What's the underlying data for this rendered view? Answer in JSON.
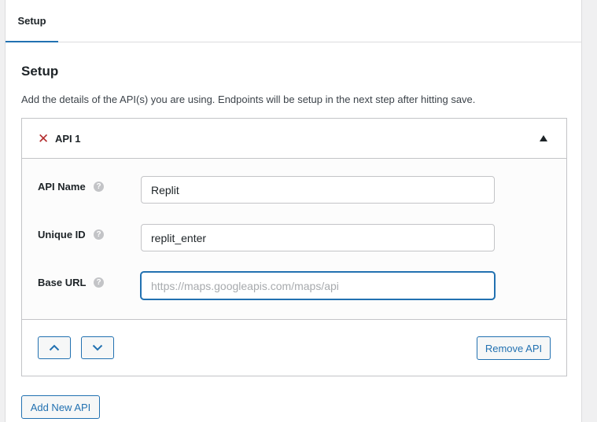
{
  "tabs": [
    {
      "label": "Setup",
      "active": true
    }
  ],
  "section": {
    "title": "Setup",
    "description": "Add the details of the API(s) you are using. Endpoints will be setup in the next step after hitting save."
  },
  "api": {
    "title": "API 1",
    "remove_symbol": "✕",
    "collapse_icon": "triangle-up-icon",
    "fields": [
      {
        "label": "API Name",
        "value": "Replit",
        "placeholder": ""
      },
      {
        "label": "Unique ID",
        "value": "replit_enter",
        "placeholder": ""
      },
      {
        "label": "Base URL",
        "value": "",
        "placeholder": "https://maps.googleapis.com/maps/api"
      }
    ],
    "help_symbol": "?",
    "remove_label": "Remove API"
  },
  "add_label": "Add New API",
  "colors": {
    "accent": "#2271b1",
    "danger": "#b32d2e",
    "border": "#c3c4c7",
    "background": "#f0f0f1"
  }
}
